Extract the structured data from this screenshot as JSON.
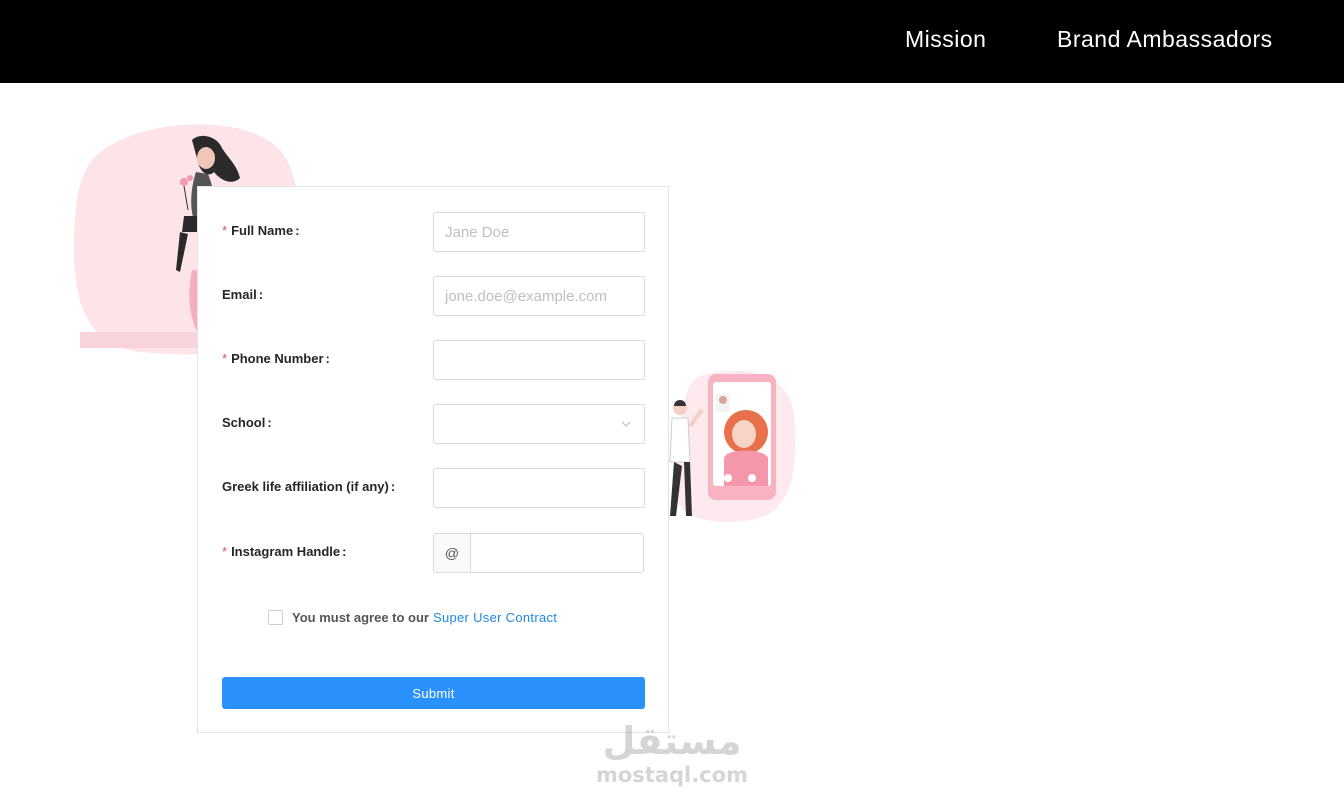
{
  "nav": {
    "items": [
      {
        "label": "Mission"
      },
      {
        "label": "Brand Ambassadors"
      }
    ]
  },
  "form": {
    "full_name": {
      "label": "Full Name",
      "required": true,
      "placeholder": "Jane Doe"
    },
    "email": {
      "label": "Email",
      "required": false,
      "placeholder": "jone.doe@example.com"
    },
    "phone": {
      "label": "Phone Number",
      "required": true,
      "placeholder": ""
    },
    "school": {
      "label": "School",
      "required": false,
      "selected": ""
    },
    "greek": {
      "label": "Greek life affiliation (if any)",
      "required": false,
      "placeholder": ""
    },
    "instagram": {
      "label": "Instagram Handle",
      "required": true,
      "addon": "@",
      "placeholder": ""
    },
    "agree": {
      "text": "You must agree to our",
      "link": "Super User Contract",
      "checked": false
    },
    "submit_label": "Submit",
    "required_mark": "*",
    "colon": ":"
  },
  "watermark": {
    "arabic": "مستقل",
    "latin": "mostaql.com"
  },
  "colors": {
    "topbar": "#000000",
    "primary": "#2a90fb",
    "link": "#1e88e5",
    "required": "#e6504b",
    "illustration_pink": "#fbe3e8"
  }
}
